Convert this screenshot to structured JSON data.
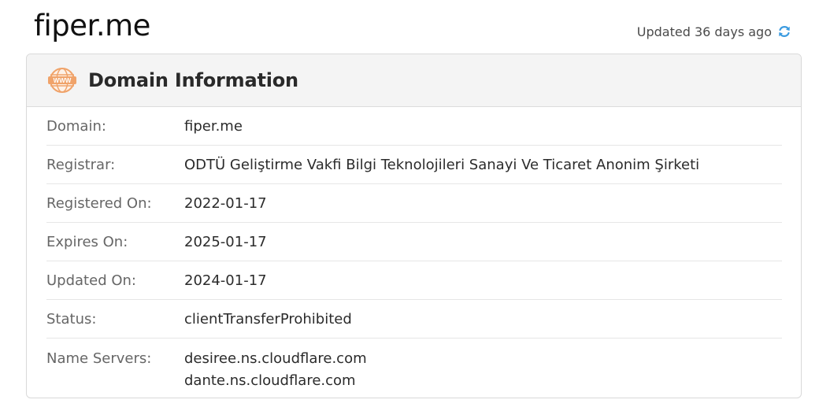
{
  "header": {
    "site_title": "fiper.me",
    "updated_text": "Updated 36 days ago",
    "refresh_icon": "refresh-icon"
  },
  "card": {
    "title": "Domain Information",
    "icon": "www-icon",
    "rows": [
      {
        "label": "Domain:",
        "value": "fiper.me"
      },
      {
        "label": "Registrar:",
        "value": "ODTÜ Geliştirme Vakfi Bilgi Teknolojileri Sanayi Ve Ticaret Anonim Şirketi"
      },
      {
        "label": "Registered On:",
        "value": "2022-01-17"
      },
      {
        "label": "Expires On:",
        "value": "2025-01-17"
      },
      {
        "label": "Updated On:",
        "value": "2024-01-17"
      },
      {
        "label": "Status:",
        "value": "clientTransferProhibited"
      },
      {
        "label": "Name Servers:",
        "values": [
          "desiree.ns.cloudflare.com",
          "dante.ns.cloudflare.com"
        ]
      }
    ]
  },
  "colors": {
    "accent_orange": "#f0a36a",
    "refresh_blue": "#3b9be0"
  }
}
